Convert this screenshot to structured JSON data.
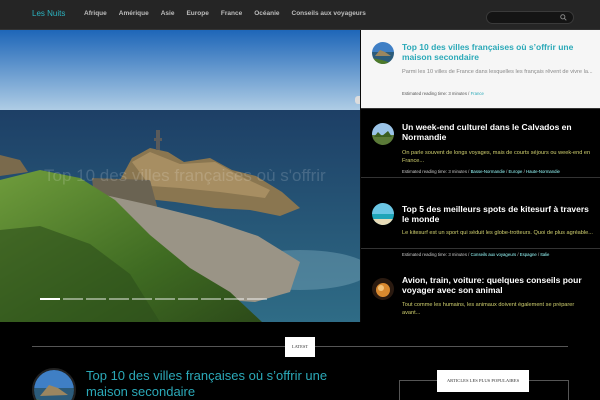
{
  "site": {
    "logo": "Les Nuits"
  },
  "nav": {
    "items": [
      {
        "label": "Afrique"
      },
      {
        "label": "Amérique"
      },
      {
        "label": "Asie"
      },
      {
        "label": "Europe"
      },
      {
        "label": "France"
      },
      {
        "label": "Océanie"
      },
      {
        "label": "Conseils aux voyageurs"
      }
    ]
  },
  "search": {
    "value": "",
    "icon": "search-icon"
  },
  "hero": {
    "caption": "Top 10 des villes françaises où s'offrir",
    "slide_count": 10,
    "active_slide": 1
  },
  "articles": [
    {
      "title": "Top 10 des villes françaises où s’offrir une maison secondaire",
      "excerpt": "Parmi les 10 villes de France dans lesquelles les français rêvent de vivre la...",
      "reading_label": "Estimated reading time: 3 minutes",
      "categories": [
        "France"
      ]
    },
    {
      "title": "Un week-end culturel dans le Calvados en Normandie",
      "excerpt": "On parle souvent de longs voyages, mais de courts séjours ou week-end en France...",
      "reading_label": "Estimated reading time: 3 minutes",
      "categories": [
        "Basse-Normandie",
        "Europe",
        "Haute-Normandie"
      ]
    },
    {
      "title": "Top 5 des meilleurs spots de kitesurf à travers le monde",
      "excerpt": "Le kitesurf est un sport qui séduit les globe-trotteurs. Quoi de plus agréable...",
      "reading_label": "Estimated reading time: 3 minutes",
      "categories": [
        "Conseils aux voyageurs",
        "Espagne",
        "Italie"
      ]
    },
    {
      "title": "Avion, train, voiture: quelques conseils pour voyager avec son animal",
      "excerpt": "Tout comme les humains, les animaux doivent également se préparer avant...",
      "reading_label": "",
      "categories": []
    }
  ],
  "latest": {
    "label": "LATEST",
    "title": "Top 10 des villes françaises où s’offrir une maison secondaire"
  },
  "popular": {
    "label": "ARTICLES LES PLUS POPULAIRES"
  }
}
